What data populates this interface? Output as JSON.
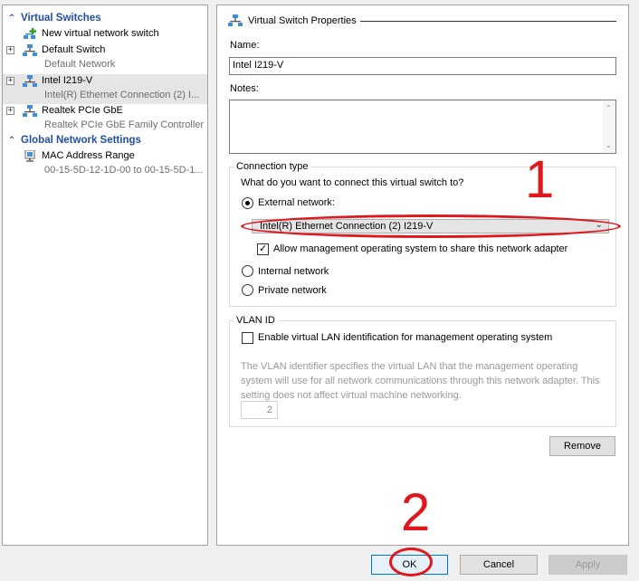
{
  "tree": {
    "virtual_switches_label": "Virtual Switches",
    "global_settings_label": "Global Network Settings",
    "items": [
      {
        "label": "New virtual network switch",
        "sub": ""
      },
      {
        "label": "Default Switch",
        "sub": "Default Network"
      },
      {
        "label": "Intel I219-V",
        "sub": "Intel(R) Ethernet Connection (2) I..."
      },
      {
        "label": "Realtek PCIe GbE",
        "sub": "Realtek PCIe GbE Family Controller"
      },
      {
        "label": "MAC Address Range",
        "sub": "00-15-5D-12-1D-00 to 00-15-5D-1..."
      }
    ]
  },
  "props": {
    "title": "Virtual Switch Properties",
    "name_label": "Name:",
    "name_value": "Intel I219-V",
    "notes_label": "Notes:",
    "notes_value": "",
    "connection": {
      "title": "Connection type",
      "question": "What do you want to connect this virtual switch to?",
      "external_label": "External network:",
      "adapter_value": "Intel(R) Ethernet Connection (2) I219-V",
      "allow_mgmt_label": "Allow management operating system to share this network adapter",
      "internal_label": "Internal network",
      "private_label": "Private network"
    },
    "vlan": {
      "title": "VLAN ID",
      "enable_label": "Enable virtual LAN identification for management operating system",
      "description": "The VLAN identifier specifies the virtual LAN that the management operating system will use for all network communications through this network adapter. This setting does not affect virtual machine networking.",
      "value": "2"
    },
    "remove_label": "Remove"
  },
  "buttons": {
    "ok": "OK",
    "cancel": "Cancel",
    "apply": "Apply"
  },
  "annotations": {
    "one": "1",
    "two": "2"
  },
  "colors": {
    "section_blue": "#1f4fa8",
    "annotation_red": "#e0181b",
    "default_button_border": "#0078d7"
  }
}
